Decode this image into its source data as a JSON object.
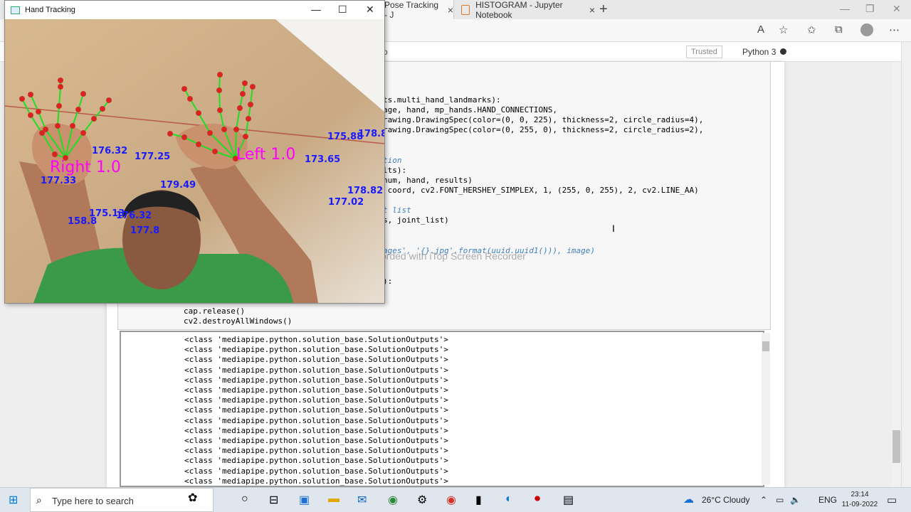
{
  "browser": {
    "tabs": [
      {
        "label": "Pose Tracking - J",
        "close": "×"
      },
      {
        "label": "HISTOGRAM - Jupyter Notebook",
        "close": "×"
      }
    ],
    "new_tab": "+"
  },
  "notebook": {
    "trusted": "Trusted",
    "kernel": "Python 3",
    "left_glyph": "o",
    "code_lines": [
      "ts.multi_hand_landmarks):",
      "age, hand, mp_hands.HAND_CONNECTIONS,",
      "rawing.DrawingSpec(color=(0, 0, 225), thickness=2, circle_radius=4),",
      "rawing.DrawingSpec(color=(0, 255, 0), thickness=2, circle_radius=2),",
      "tion",
      "lts):",
      "num, hand, results)",
      " coord, cv2.FONT_HERSHEY_SIMPLEX, 1, (255, 0, 255), 2, cv2.LINE_AA)",
      "t list",
      "s, joint_list)",
      "ages', '{}.jpg'.format(uuid.uuid1())), image)",
      "):",
      "cap.release()",
      "cv2.destroyAllWindows()"
    ],
    "output_lines": [
      "<class 'mediapipe.python.solution_base.SolutionOutputs'>",
      "<class 'mediapipe.python.solution_base.SolutionOutputs'>",
      "<class 'mediapipe.python.solution_base.SolutionOutputs'>",
      "<class 'mediapipe.python.solution_base.SolutionOutputs'>",
      "<class 'mediapipe.python.solution_base.SolutionOutputs'>",
      "<class 'mediapipe.python.solution_base.SolutionOutputs'>",
      "<class 'mediapipe.python.solution_base.SolutionOutputs'>",
      "<class 'mediapipe.python.solution_base.SolutionOutputs'>",
      "<class 'mediapipe.python.solution_base.SolutionOutputs'>",
      "<class 'mediapipe.python.solution_base.SolutionOutputs'>",
      "<class 'mediapipe.python.solution_base.SolutionOutputs'>",
      "<class 'mediapipe.python.solution_base.SolutionOutputs'>",
      "<class 'mediapipe.python.solution_base.SolutionOutputs'>",
      "<class 'mediapipe.python.solution_base.SolutionOutputs'>",
      "<class 'mediapipe.python.solution_base.SolutionOutputs'>"
    ]
  },
  "watermark": "Recorded with iTop Screen Recorder",
  "hand_window": {
    "title": "Hand Tracking",
    "labels": {
      "right": "Right 1.0",
      "left": "Left 1.0"
    },
    "angles": [
      "176.32",
      "177.25",
      "177.33",
      "179.49",
      "175.13",
      "176.32",
      "158.8",
      "177.8",
      "175.88",
      "178.8",
      "173.65",
      "178.82",
      "177.02"
    ]
  },
  "taskbar": {
    "search_placeholder": "Type here to search",
    "weather": "26°C Cloudy",
    "lang": "ENG",
    "time": "23:14",
    "date": "11-09-2022"
  },
  "colors": {
    "accent": "#0078d7",
    "landmark": "#e0201e",
    "connection": "#22dd22",
    "label": "#ff00ff",
    "angle": "#1a1aff"
  }
}
